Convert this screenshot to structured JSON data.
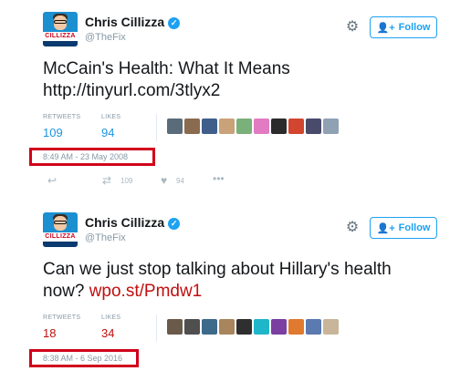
{
  "tweets": [
    {
      "name": "Chris Cillizza",
      "handle": "@TheFix",
      "follow_label": "Follow",
      "avatar_text": "CILLIZZA",
      "text_line1": "McCain's Health: What It Means",
      "text_line2": "http://tinyurl.com/3tlyx2",
      "retweets_label": "RETWEETS",
      "likes_label": "LIKES",
      "retweets": "109",
      "likes": "94",
      "timestamp": "8:49 AM - 23 May 2008",
      "action_retweets": "109",
      "action_likes": "94"
    },
    {
      "name": "Chris Cillizza",
      "handle": "@TheFix",
      "follow_label": "Follow",
      "avatar_text": "CILLIZZA",
      "text_line1": "Can we just stop talking about Hillary's health",
      "text_line2_prefix": "now? ",
      "text_link": "wpo.st/Pmdw1",
      "retweets_label": "RETWEETS",
      "likes_label": "LIKES",
      "retweets": "18",
      "likes": "34",
      "timestamp": "8:38 AM - 6 Sep 2016"
    }
  ],
  "icons": {
    "verified": "verified-badge-icon",
    "settings": "gear-icon",
    "follow": "add-person-icon",
    "reply": "reply-icon",
    "retweet": "retweet-icon",
    "like": "heart-icon",
    "more": "more-dots-icon"
  },
  "colors": {
    "accent": "#1da1f2",
    "highlight_box": "#d0021b",
    "link_red": "#c00f0f"
  }
}
